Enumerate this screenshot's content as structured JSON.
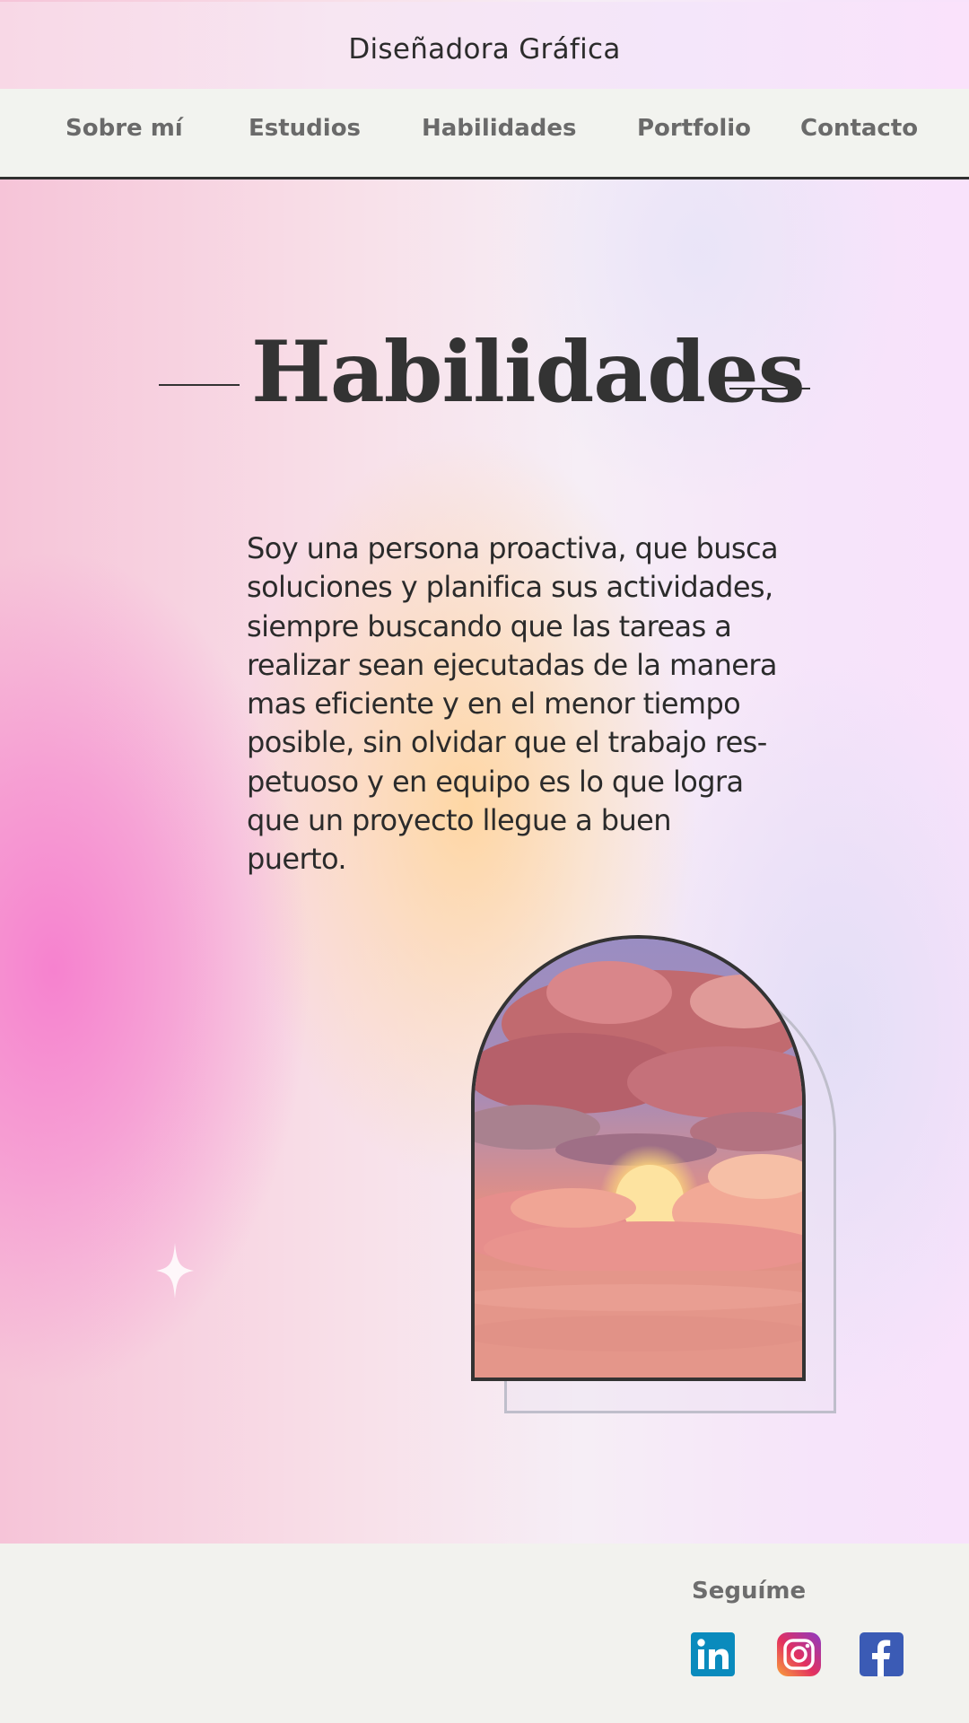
{
  "header": {
    "title": "Diseñadora Gráfica"
  },
  "nav": {
    "items": [
      {
        "label": "Sobre mí"
      },
      {
        "label": "Estudios"
      },
      {
        "label": "Habilidades"
      },
      {
        "label": "Portfolio"
      },
      {
        "label": "Contacto"
      }
    ]
  },
  "section": {
    "title": "Habilidades",
    "lines": [
      "Soy una persona proactiva, que busca",
      "soluciones y planifica sus actividades,",
      "siempre buscando que las tareas a",
      "realizar sean ejecutadas de la manera",
      "mas eficiente y en el menor tiempo",
      "posible, sin olvidar que el trabajo res-",
      "petuoso y en equipo es lo que logra",
      "que un proyecto llegue a buen",
      "puerto."
    ]
  },
  "footer": {
    "follow_label": "Seguíme",
    "socials": [
      {
        "icon": "linkedin-icon",
        "color": "#0a8bbd"
      },
      {
        "icon": "instagram-icon",
        "color": "#d6307a"
      },
      {
        "icon": "facebook-icon",
        "color": "#3b5bb5"
      }
    ]
  }
}
